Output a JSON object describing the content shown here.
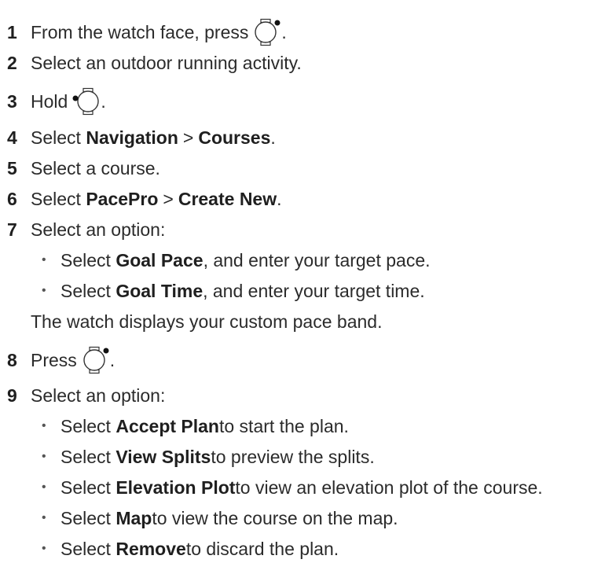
{
  "steps": [
    {
      "num": "1",
      "pre": "From the watch face, press",
      "post": ".",
      "icon": "watch-button-upper-right-icon"
    },
    {
      "num": "2",
      "text": "Select an outdoor running activity."
    },
    {
      "num": "3",
      "pre": "Hold",
      "post": ".",
      "icon": "watch-button-left-icon"
    },
    {
      "num": "4",
      "pre": "Select",
      "b1": "Navigation",
      "sep": ">",
      "b2": "Courses",
      "post": "."
    },
    {
      "num": "5",
      "text": "Select a course."
    },
    {
      "num": "6",
      "pre": "Select",
      "b1": "PacePro",
      "sep": ">",
      "b2": "Create New",
      "post": "."
    },
    {
      "num": "7",
      "text": "Select an option:",
      "options": [
        {
          "pre": "Select",
          "bold": "Goal Pace",
          "post": ", and enter your target pace."
        },
        {
          "pre": "Select",
          "bold": "Goal Time",
          "post": ", and enter your target time."
        }
      ],
      "note": "The watch displays your custom pace band."
    },
    {
      "num": "8",
      "pre": "Press",
      "post": ".",
      "icon": "watch-button-upper-right-icon"
    },
    {
      "num": "9",
      "text": "Select an option:",
      "options": [
        {
          "pre": "Select",
          "bold": "Accept Plan",
          "post": " to start the plan."
        },
        {
          "pre": "Select",
          "bold": "View Splits",
          "post": " to preview the splits."
        },
        {
          "pre": "Select",
          "bold": "Elevation Plot",
          "post": " to view an elevation plot of the course."
        },
        {
          "pre": "Select",
          "bold": "Map",
          "post": " to view the course on the map."
        },
        {
          "pre": "Select",
          "bold": "Remove",
          "post": " to discard the plan."
        }
      ]
    }
  ],
  "bullet_char": "•"
}
